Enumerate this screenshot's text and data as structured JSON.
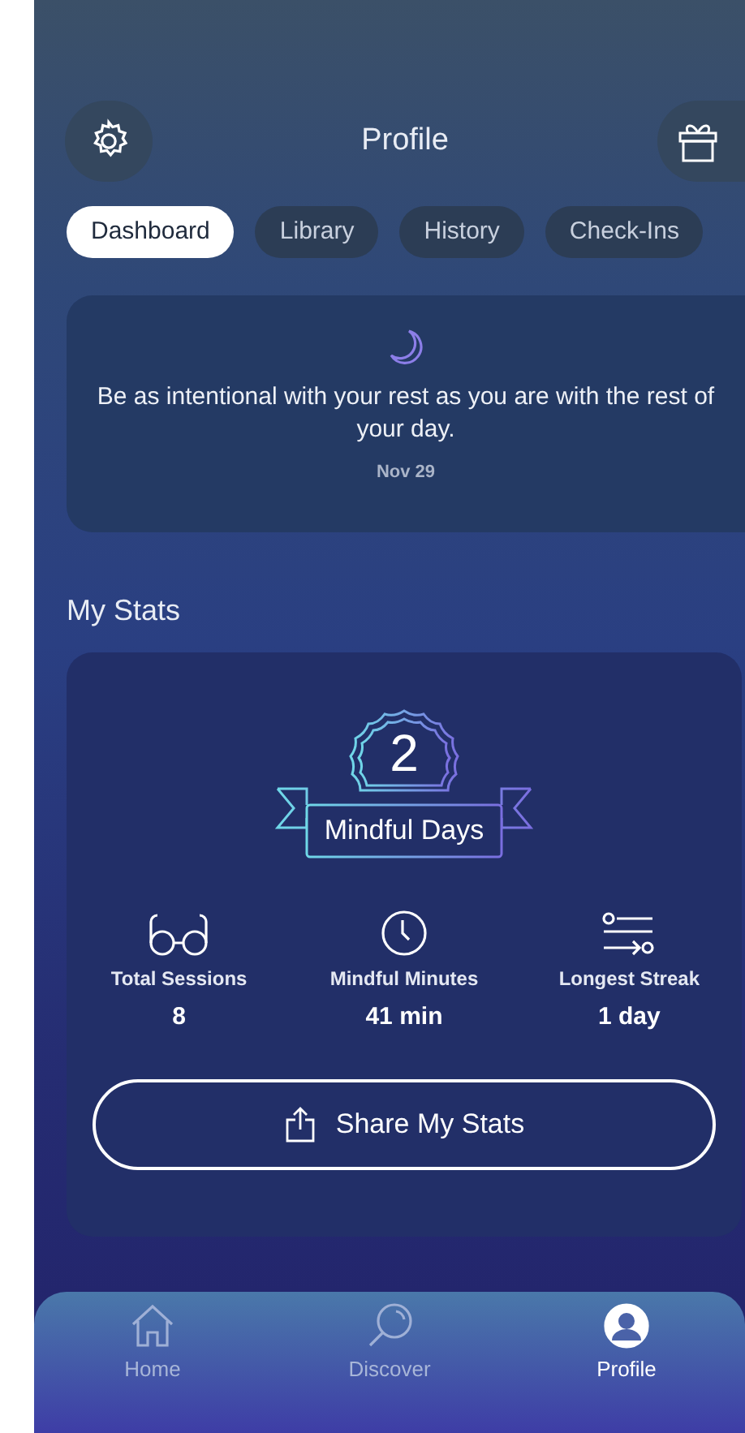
{
  "header": {
    "title": "Profile"
  },
  "tabs": [
    {
      "label": "Dashboard",
      "selected": true
    },
    {
      "label": "Library",
      "selected": false
    },
    {
      "label": "History",
      "selected": false
    },
    {
      "label": "Check-Ins",
      "selected": false
    }
  ],
  "quote": {
    "text": "Be as intentional with your rest as you are with the rest of your day.",
    "date": "Nov 29"
  },
  "stats": {
    "title": "My Stats",
    "badge": {
      "count": "2",
      "label": "Mindful Days"
    },
    "items": [
      {
        "kind": "sessions",
        "label": "Total Sessions",
        "value": "8"
      },
      {
        "kind": "minutes",
        "label": "Mindful Minutes",
        "value": "41 min"
      },
      {
        "kind": "streak",
        "label": "Longest Streak",
        "value": "1 day"
      }
    ],
    "share_button": "Share My Stats"
  },
  "nav": [
    {
      "kind": "home",
      "label": "Home",
      "selected": false
    },
    {
      "kind": "discover",
      "label": "Discover",
      "selected": false
    },
    {
      "kind": "profile",
      "label": "Profile",
      "selected": true
    }
  ]
}
